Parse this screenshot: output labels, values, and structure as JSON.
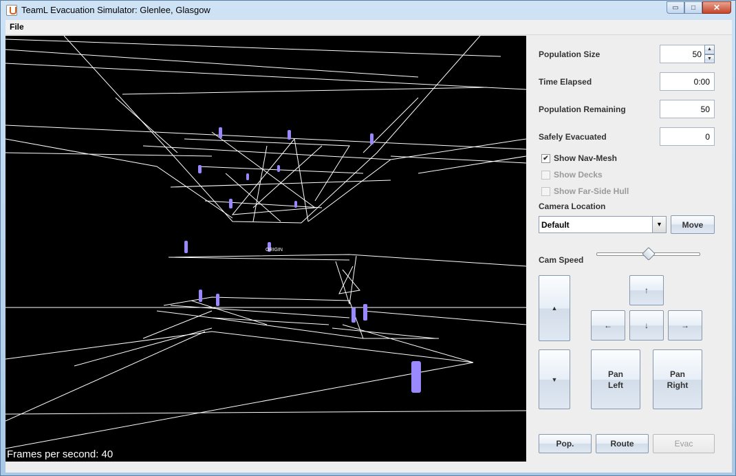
{
  "window": {
    "title": "TeamL Evacuation Simulator: Glenlee, Glasgow",
    "min_glyph": "▭",
    "max_glyph": "□",
    "close_glyph": "✕"
  },
  "menu": {
    "file": "File"
  },
  "viewport": {
    "fps_label": "Frames per second: 40",
    "origin_label": "ORIGIN"
  },
  "panel": {
    "population_size": {
      "label": "Population Size",
      "value": "50"
    },
    "time_elapsed": {
      "label": "Time Elapsed",
      "value": "0:00"
    },
    "population_remaining": {
      "label": "Population Remaining",
      "value": "50"
    },
    "safely_evacuated": {
      "label": "Safely Evacuated",
      "value": "0"
    },
    "show_nav_mesh": {
      "label": "Show Nav-Mesh",
      "checked": true,
      "mark": "✔"
    },
    "show_decks": {
      "label": "Show Decks",
      "checked": false,
      "mark": ""
    },
    "show_far_side_hull": {
      "label": "Show Far-Side Hull",
      "checked": false,
      "mark": ""
    },
    "camera_location": {
      "label": "Camera Location",
      "selected": "Default",
      "arrow": "▼"
    },
    "move_label": "Move",
    "cam_speed": {
      "label": "Cam Speed",
      "level": 0.5
    },
    "buttons": {
      "zoom_up": "▲",
      "zoom_down": "▼",
      "up": "↑",
      "down": "↓",
      "left": "←",
      "right": "→",
      "pan_left": "Pan\nLeft",
      "pan_right": "Pan\nRight",
      "pop": "Pop.",
      "route": "Route",
      "evac": "Evac"
    },
    "spin_up": "▲",
    "spin_down": "▼"
  }
}
